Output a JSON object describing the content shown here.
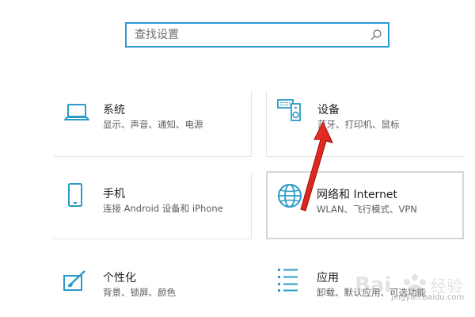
{
  "search": {
    "placeholder": "查找设置",
    "value": ""
  },
  "tiles": [
    {
      "title": "系统",
      "subtitle": "显示、声音、通知、电源",
      "icon": "laptop-icon"
    },
    {
      "title": "设备",
      "subtitle": "蓝牙、打印机、鼠标",
      "icon": "keyboard-speaker-icon"
    },
    {
      "title": "手机",
      "subtitle": "连接 Android 设备和 iPhone",
      "icon": "phone-icon"
    },
    {
      "title": "网络和 Internet",
      "subtitle": "WLAN、飞行模式、VPN",
      "icon": "globe-icon"
    },
    {
      "title": "个性化",
      "subtitle": "背景、锁屏、颜色",
      "icon": "paint-brush-icon"
    },
    {
      "title": "应用",
      "subtitle": "卸载、默认应用、可选功能",
      "icon": "apps-list-icon"
    }
  ],
  "watermark": {
    "text": "jingyan.baidu.com"
  },
  "colors": {
    "accent": "#2b9bd4",
    "icon": "#2a9bc8",
    "arrow": "#e0211b"
  }
}
